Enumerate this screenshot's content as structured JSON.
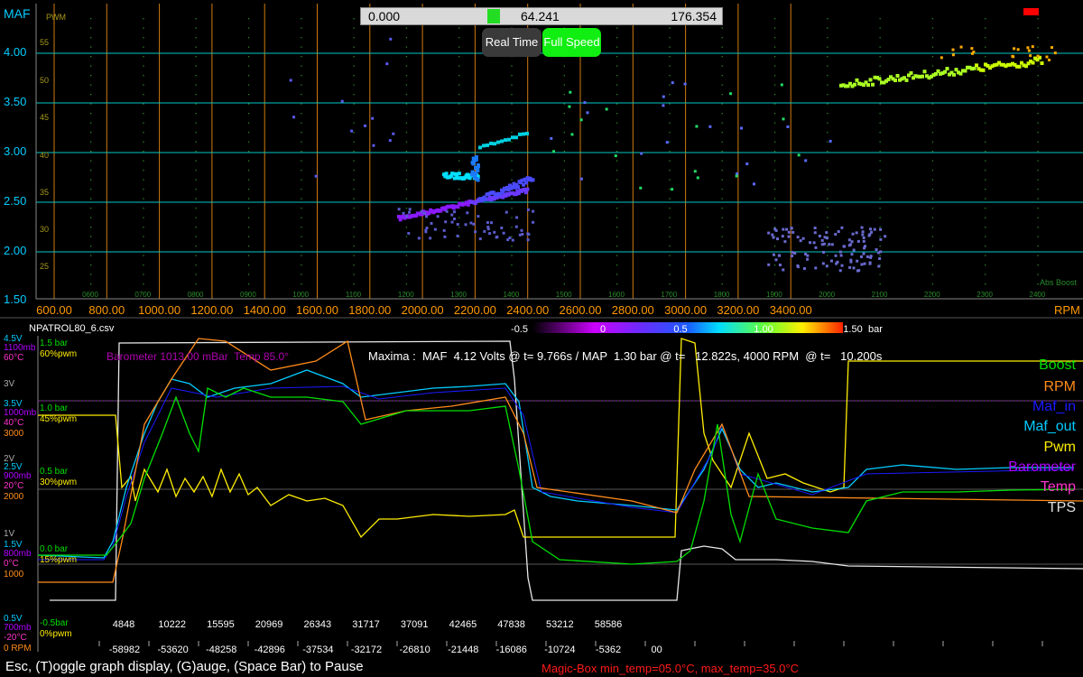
{
  "slider": {
    "min": "0.000",
    "current": "64.241",
    "max": "176.354"
  },
  "buttons": {
    "realtime": "Real Time",
    "fullspeed": "Full Speed"
  },
  "top_chart": {
    "y_label": "MAF",
    "pwm_label": "PWM",
    "x_unit": "RPM",
    "abs_boost_label": "Abs Boost",
    "y_ticks": [
      "4.00",
      "3.50",
      "3.00",
      "2.50",
      "2.00",
      "1.50"
    ],
    "pwm_ticks": [
      "55",
      "50",
      "45",
      "40",
      "35",
      "30",
      "25"
    ],
    "x_ticks": [
      "600.00",
      "800.00",
      "1000.00",
      "1200.00",
      "1400.00",
      "1600.00",
      "1800.00",
      "2000.00",
      "2200.00",
      "2400.00",
      "2600.00",
      "2800.00",
      "3000.00",
      "3200.00",
      "3400.00"
    ],
    "rpm_ticks": [
      "0600",
      "0700",
      "0800",
      "0900",
      "1000",
      "1100",
      "1200",
      "1300",
      "1400",
      "1500",
      "1600",
      "1700",
      "1800",
      "1900",
      "2000",
      "2100",
      "2200",
      "2300",
      "2400"
    ],
    "colors": {
      "grid_h": "#00c8c8",
      "grid_v": "#d07a10",
      "axis_text": "#00ccff",
      "x_text": "#ff9900"
    }
  },
  "colorbar": {
    "labels": [
      "-0.5",
      "0",
      "0.5",
      "1.00",
      "1.50"
    ],
    "unit": "bar"
  },
  "file": {
    "name": "NPATROL80_6.csv"
  },
  "bottom_chart": {
    "barometer_text": "Barometer 1013.00 mBar  Temp 85.0°",
    "maxima_text": "Maxima :  MAF  4.12 Volts @ t= 9.766s / MAP  1.30 bar @ t=   12.822s, 4000 RPM  @ t=   10.200s",
    "legend": [
      {
        "name": "Boost",
        "color": "#00e000"
      },
      {
        "name": "RPM",
        "color": "#ff8c1a"
      },
      {
        "name": "Maf_in",
        "color": "#1a1aff"
      },
      {
        "name": "Maf_out",
        "color": "#00ccff"
      },
      {
        "name": "Pwm",
        "color": "#ffee00"
      },
      {
        "name": "Barometer",
        "color": "#b000ff"
      },
      {
        "name": "Temp",
        "color": "#ff33cc"
      },
      {
        "name": "TPS",
        "color": "#e0e0e0"
      }
    ],
    "time_ticks_top": [
      "4848",
      "10222",
      "15595",
      "20969",
      "26343",
      "31717",
      "37091",
      "42465",
      "47838",
      "53212",
      "58586"
    ],
    "time_ticks_bottom": [
      "-58982",
      "-53620",
      "-48258",
      "-42896",
      "-37534",
      "-32172",
      "-26810",
      "-21448",
      "-16086",
      "-10724",
      "-5362",
      "00"
    ],
    "scale_rows": [
      {
        "maf": "4.5V",
        "baro": "1100mb",
        "temp": "60°C",
        "rpm": "",
        "boost": "1.5 bar",
        "pwm": "60%pwm"
      },
      {
        "maf": "3.5V",
        "baro": "1000mb",
        "temp": "40°C",
        "rpm": "3000",
        "boost": "1.0 bar",
        "pwm": "45%pwm"
      },
      {
        "maf": "2.5V",
        "baro": "900mb",
        "temp": "20°C",
        "rpm": "2000",
        "boost": "0.5 bar",
        "pwm": "30%pwm"
      },
      {
        "maf": "1.5V",
        "baro": "800mb",
        "temp": "0°C",
        "rpm": "1000",
        "boost": "0.0 bar",
        "pwm": "15%pwm"
      },
      {
        "maf": "0.5V",
        "baro": "700mb",
        "temp": "-20°C",
        "rpm": "0 RPM",
        "boost": "-0.5bar",
        "pwm": "0%pwm"
      }
    ],
    "extra_labels": {
      "v3": "3V",
      "v2": "2V",
      "v1": "1V"
    }
  },
  "status": {
    "help_text": "Esc, (T)oggle graph display, (G)auge, (Space Bar) to Pause",
    "magic_text": "Magic-Box  min_temp=05.0°C, max_temp=35.0°C"
  }
}
